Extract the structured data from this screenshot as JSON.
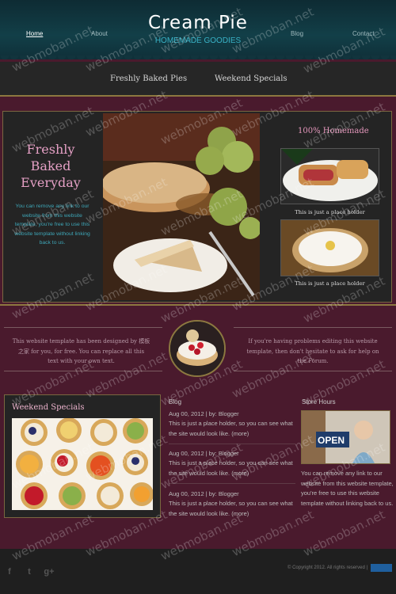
{
  "header": {
    "nav": [
      "Home",
      "About",
      "Blog",
      "Contact"
    ],
    "logo_title": "Cream Pie",
    "logo_subtitle": "HOMEMADE GOODIES"
  },
  "subnav": [
    "Freshly Baked Pies",
    "Weekend Specials"
  ],
  "feature": {
    "title_lines": [
      "Freshly",
      "Baked",
      "Everyday"
    ],
    "text": "You can remove any link to our website from this website template, you're free to use this website template without linking back to us.",
    "side_title": "100% Homemade",
    "captions": [
      "This is just a place holder",
      "This is just a place holder"
    ]
  },
  "middle": {
    "left_text": "This website template has been designed by 模板之家 for you, for free. You can replace all this text with your own text.",
    "right_text": "If you're having problems editing this website template, then don't hesitate to ask for help on the Forum."
  },
  "specials": {
    "title": "Weekend Specials"
  },
  "blog": {
    "title": "Blog",
    "posts": [
      {
        "meta": "Aug 00, 2012 | by: Blogger",
        "text": "This is just a place holder, so you can see what the site would look like. (more)"
      },
      {
        "meta": "Aug 00, 2012 | by: Blogger",
        "text": "This is just a place holder, so you can see what the site would look like. (more)"
      },
      {
        "meta": "Aug 00, 2012 | by: Blogger",
        "text": "This is just a place holder, so you can see what the site would look like. (more)"
      }
    ]
  },
  "store": {
    "title": "Store Hours",
    "sign": "OPEN",
    "text": "You can remove any link to our website from this website template, you're free to use this website template without linking back to us."
  },
  "footer": {
    "copyright": "© Copyright 2012. All rights reserved |",
    "social_icons": [
      "facebook-icon",
      "twitter-icon",
      "google-plus-icon"
    ]
  },
  "watermark": "webmoban.net",
  "colors": {
    "header_bg": "#123f48",
    "page_bg": "#4a1a2d",
    "accent_pink": "#e5a0c5",
    "accent_teal": "#3ea6b7",
    "gold": "#8c7840"
  }
}
